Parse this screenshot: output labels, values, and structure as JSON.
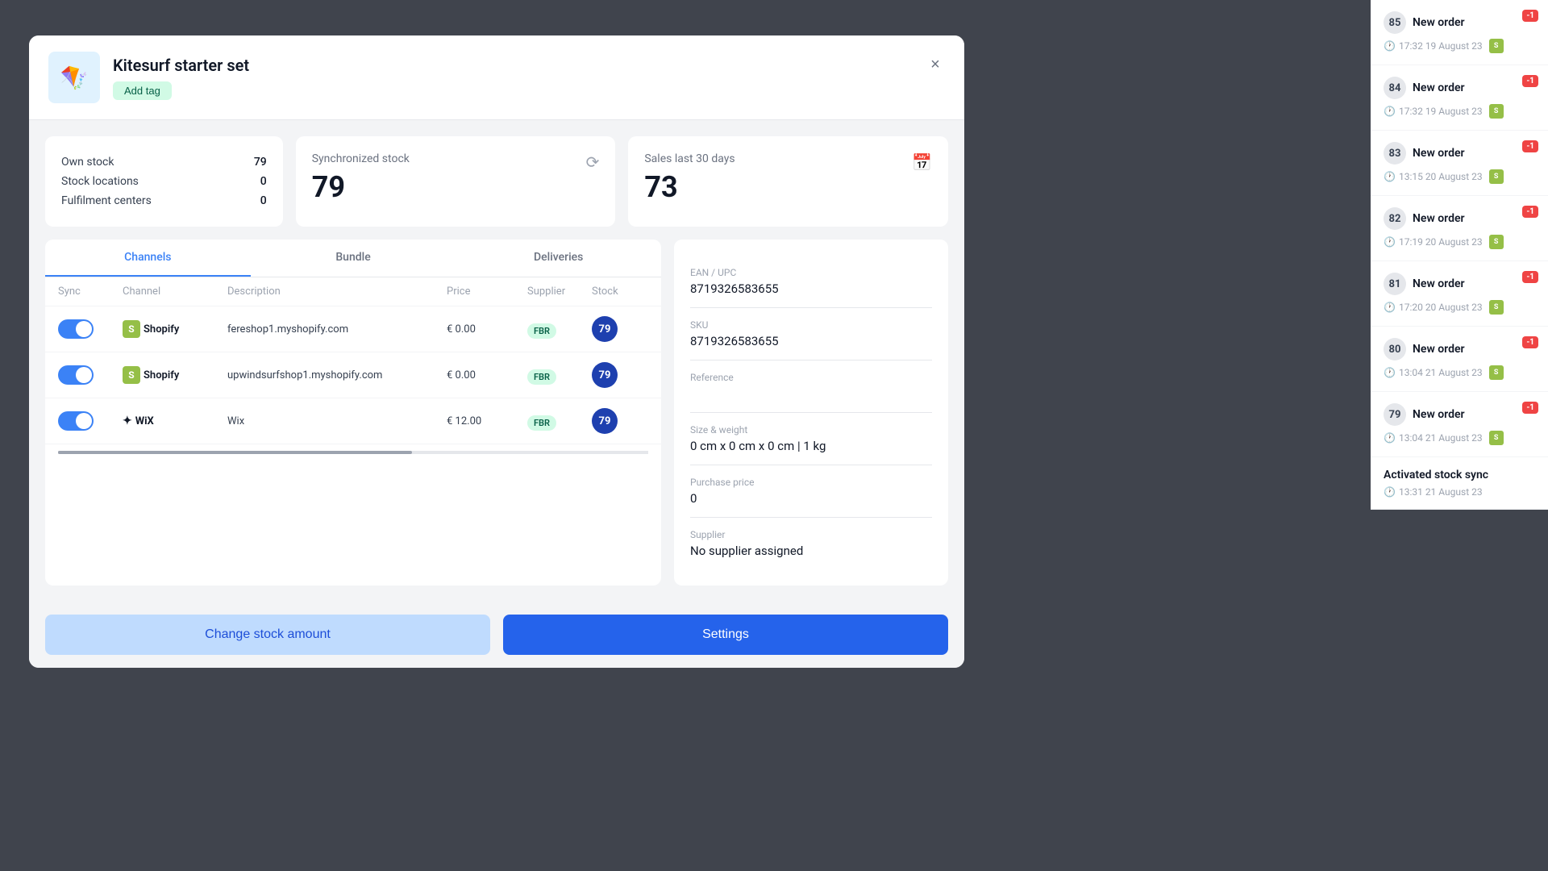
{
  "modal": {
    "title": "Kitesurf starter set",
    "add_tag_label": "Add tag",
    "close_label": "×"
  },
  "stats": {
    "own_stock_label": "Own stock",
    "own_stock_value": "79",
    "stock_locations_label": "Stock locations",
    "stock_locations_value": "0",
    "fulfilment_centers_label": "Fulfilment centers",
    "fulfilment_centers_value": "0",
    "synchronized_stock_label": "Synchronized stock",
    "synchronized_stock_value": "79",
    "sales_last_label": "Sales last 30 days",
    "sales_last_value": "73"
  },
  "tabs": [
    {
      "label": "Channels",
      "active": true
    },
    {
      "label": "Bundle",
      "active": false
    },
    {
      "label": "Deliveries",
      "active": false
    }
  ],
  "table": {
    "columns": [
      "Sync",
      "Channel",
      "Description",
      "Price",
      "Supplier",
      "Stock"
    ],
    "rows": [
      {
        "channel_type": "shopify",
        "channel_name": "Shopify",
        "description": "fereshop1.myshopify.com",
        "price": "€ 0.00",
        "supplier": "FBR",
        "stock": "79",
        "enabled": true
      },
      {
        "channel_type": "shopify",
        "channel_name": "Shopify",
        "description": "upwindsurfshop1.myshopify.com",
        "price": "€ 0.00",
        "supplier": "FBR",
        "stock": "79",
        "enabled": true
      },
      {
        "channel_type": "wix",
        "channel_name": "WiX",
        "description": "Wix",
        "price": "€ 12.00",
        "supplier": "FBR",
        "stock": "79",
        "enabled": true
      }
    ]
  },
  "details": {
    "ean_label": "EAN / UPC",
    "ean_value": "8719326583655",
    "sku_label": "SKU",
    "sku_value": "8719326583655",
    "reference_label": "Reference",
    "reference_value": "",
    "size_weight_label": "Size & weight",
    "size_weight_value": "0 cm x 0 cm x 0 cm | 1 kg",
    "purchase_price_label": "Purchase price",
    "purchase_price_value": "0",
    "supplier_label": "Supplier",
    "supplier_value": "No supplier assigned"
  },
  "footer": {
    "change_stock_label": "Change stock amount",
    "settings_label": "Settings"
  },
  "sidebar": {
    "orders": [
      {
        "number": "85",
        "title": "New order",
        "time": "17:32 19 August 23",
        "badge": "-1"
      },
      {
        "number": "84",
        "title": "New order",
        "time": "17:32 19 August 23",
        "badge": "-1"
      },
      {
        "number": "83",
        "title": "New order",
        "time": "13:15 20 August 23",
        "badge": "-1"
      },
      {
        "number": "82",
        "title": "New order",
        "time": "17:19 20 August 23",
        "badge": "-1"
      },
      {
        "number": "81",
        "title": "New order",
        "time": "17:20 20 August 23",
        "badge": "-1"
      },
      {
        "number": "80",
        "title": "New order",
        "time": "13:04 21 August 23",
        "badge": "-1"
      },
      {
        "number": "79",
        "title": "New order",
        "time": "13:04 21 August 23",
        "badge": "-1"
      }
    ],
    "activated": {
      "title": "Activated stock sync",
      "time": "13:31 21 August 23"
    }
  }
}
